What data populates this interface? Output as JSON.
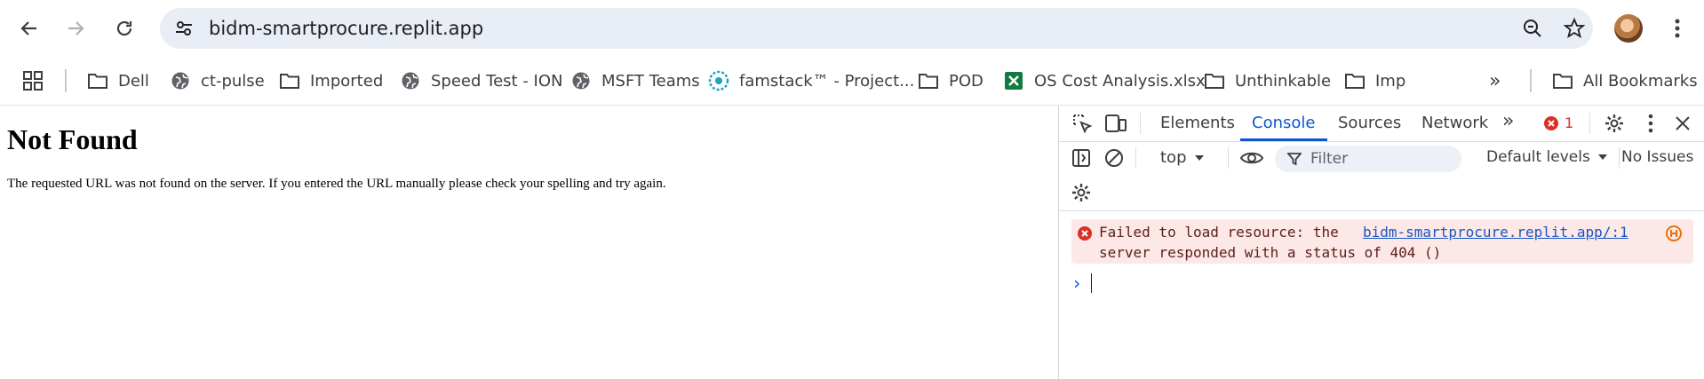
{
  "browser": {
    "url": "bidm-smartprocure.replit.app",
    "bookmarks": [
      {
        "label": "Dell",
        "icon": "folder-icon"
      },
      {
        "label": "ct-pulse",
        "icon": "globe-icon"
      },
      {
        "label": "Imported",
        "icon": "folder-icon"
      },
      {
        "label": "Speed Test - ION",
        "icon": "globe-icon"
      },
      {
        "label": "MSFT Teams",
        "icon": "globe-icon"
      },
      {
        "label": "famstack™ - Project...",
        "icon": "famstack-icon"
      },
      {
        "label": "POD",
        "icon": "folder-icon"
      },
      {
        "label": "OS Cost Analysis.xlsx",
        "icon": "excel-icon"
      },
      {
        "label": "Unthinkable",
        "icon": "folder-icon"
      },
      {
        "label": "Imp",
        "icon": "folder-icon"
      }
    ],
    "all_bookmarks": "All Bookmarks",
    "overflow": "»"
  },
  "page": {
    "heading": "Not Found",
    "message": "The requested URL was not found on the server. If you entered the URL manually please check your spelling and try again."
  },
  "devtools": {
    "tabs": [
      "Elements",
      "Console",
      "Sources",
      "Network"
    ],
    "active_tab": "Console",
    "more_tabs": "»",
    "error_count": "1",
    "context": "top",
    "filter_placeholder": "Filter",
    "levels": "Default levels",
    "issues": "No Issues",
    "console": {
      "error_line1": "Failed to load resource: the",
      "error_line2": "server responded with a status of 404 ()",
      "error_link": "bidm-smartprocure.replit.app/:1",
      "prompt": "›"
    },
    "colors": {
      "accent": "#0b57d0",
      "error": "#d93025",
      "error_bg": "#fce8e6"
    }
  }
}
